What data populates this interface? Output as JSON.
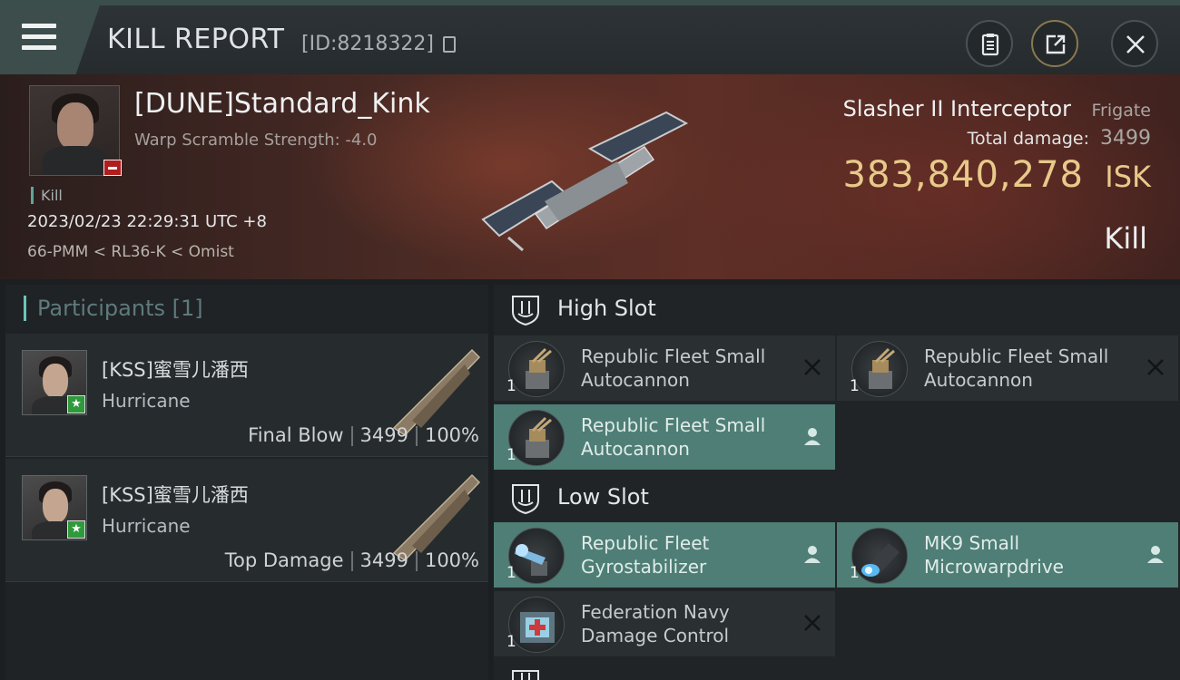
{
  "header": {
    "title": "KILL REPORT",
    "report_id": "[ID:8218322]",
    "icons": [
      "menu-icon",
      "copy-icon",
      "clipboard-icon",
      "share-icon",
      "close-icon"
    ]
  },
  "victim": {
    "name": "[DUNE]Standard_Kink",
    "scramble": "Warp Scramble Strength: -4.0",
    "tag": "Kill",
    "timestamp": "2023/02/23 22:29:31 UTC +8",
    "location": "66-PMM < RL36-K < Omist",
    "ship_name": "Slasher II Interceptor",
    "ship_class": "Frigate",
    "damage_label": "Total damage:",
    "damage_value": "3499",
    "isk_value": "383,840,278",
    "isk_unit": "ISK",
    "result": "Kill"
  },
  "participants": {
    "title": "Participants [1]",
    "items": [
      {
        "name": "[KSS]蜜雪儿潘西",
        "ship": "Hurricane",
        "role": "Final Blow",
        "damage": "3499",
        "percent": "100%"
      },
      {
        "name": "[KSS]蜜雪儿潘西",
        "ship": "Hurricane",
        "role": "Top Damage",
        "damage": "3499",
        "percent": "100%"
      }
    ]
  },
  "slots": {
    "high": {
      "label": "High Slot",
      "modules": [
        {
          "name": "Republic Fleet Small Autocannon",
          "qty": "1",
          "status": "destroyed"
        },
        {
          "name": "Republic Fleet Small Autocannon",
          "qty": "1",
          "status": "destroyed"
        },
        {
          "name": "Republic Fleet Small Autocannon",
          "qty": "1",
          "status": "dropped"
        }
      ]
    },
    "low": {
      "label": "Low Slot",
      "modules": [
        {
          "name": "Republic Fleet Gyrostabilizer",
          "qty": "1",
          "status": "dropped"
        },
        {
          "name": "MK9 Small Microwarpdrive",
          "qty": "1",
          "status": "dropped"
        },
        {
          "name": "Federation Navy Damage Control",
          "qty": "1",
          "status": "destroyed"
        }
      ]
    }
  },
  "colors": {
    "accent": "#6cc4b8",
    "isk": "#e8c98a",
    "fitted_row": "#4e7e76",
    "badge_red": "#b01e1e",
    "badge_green": "#2f9a3c"
  }
}
